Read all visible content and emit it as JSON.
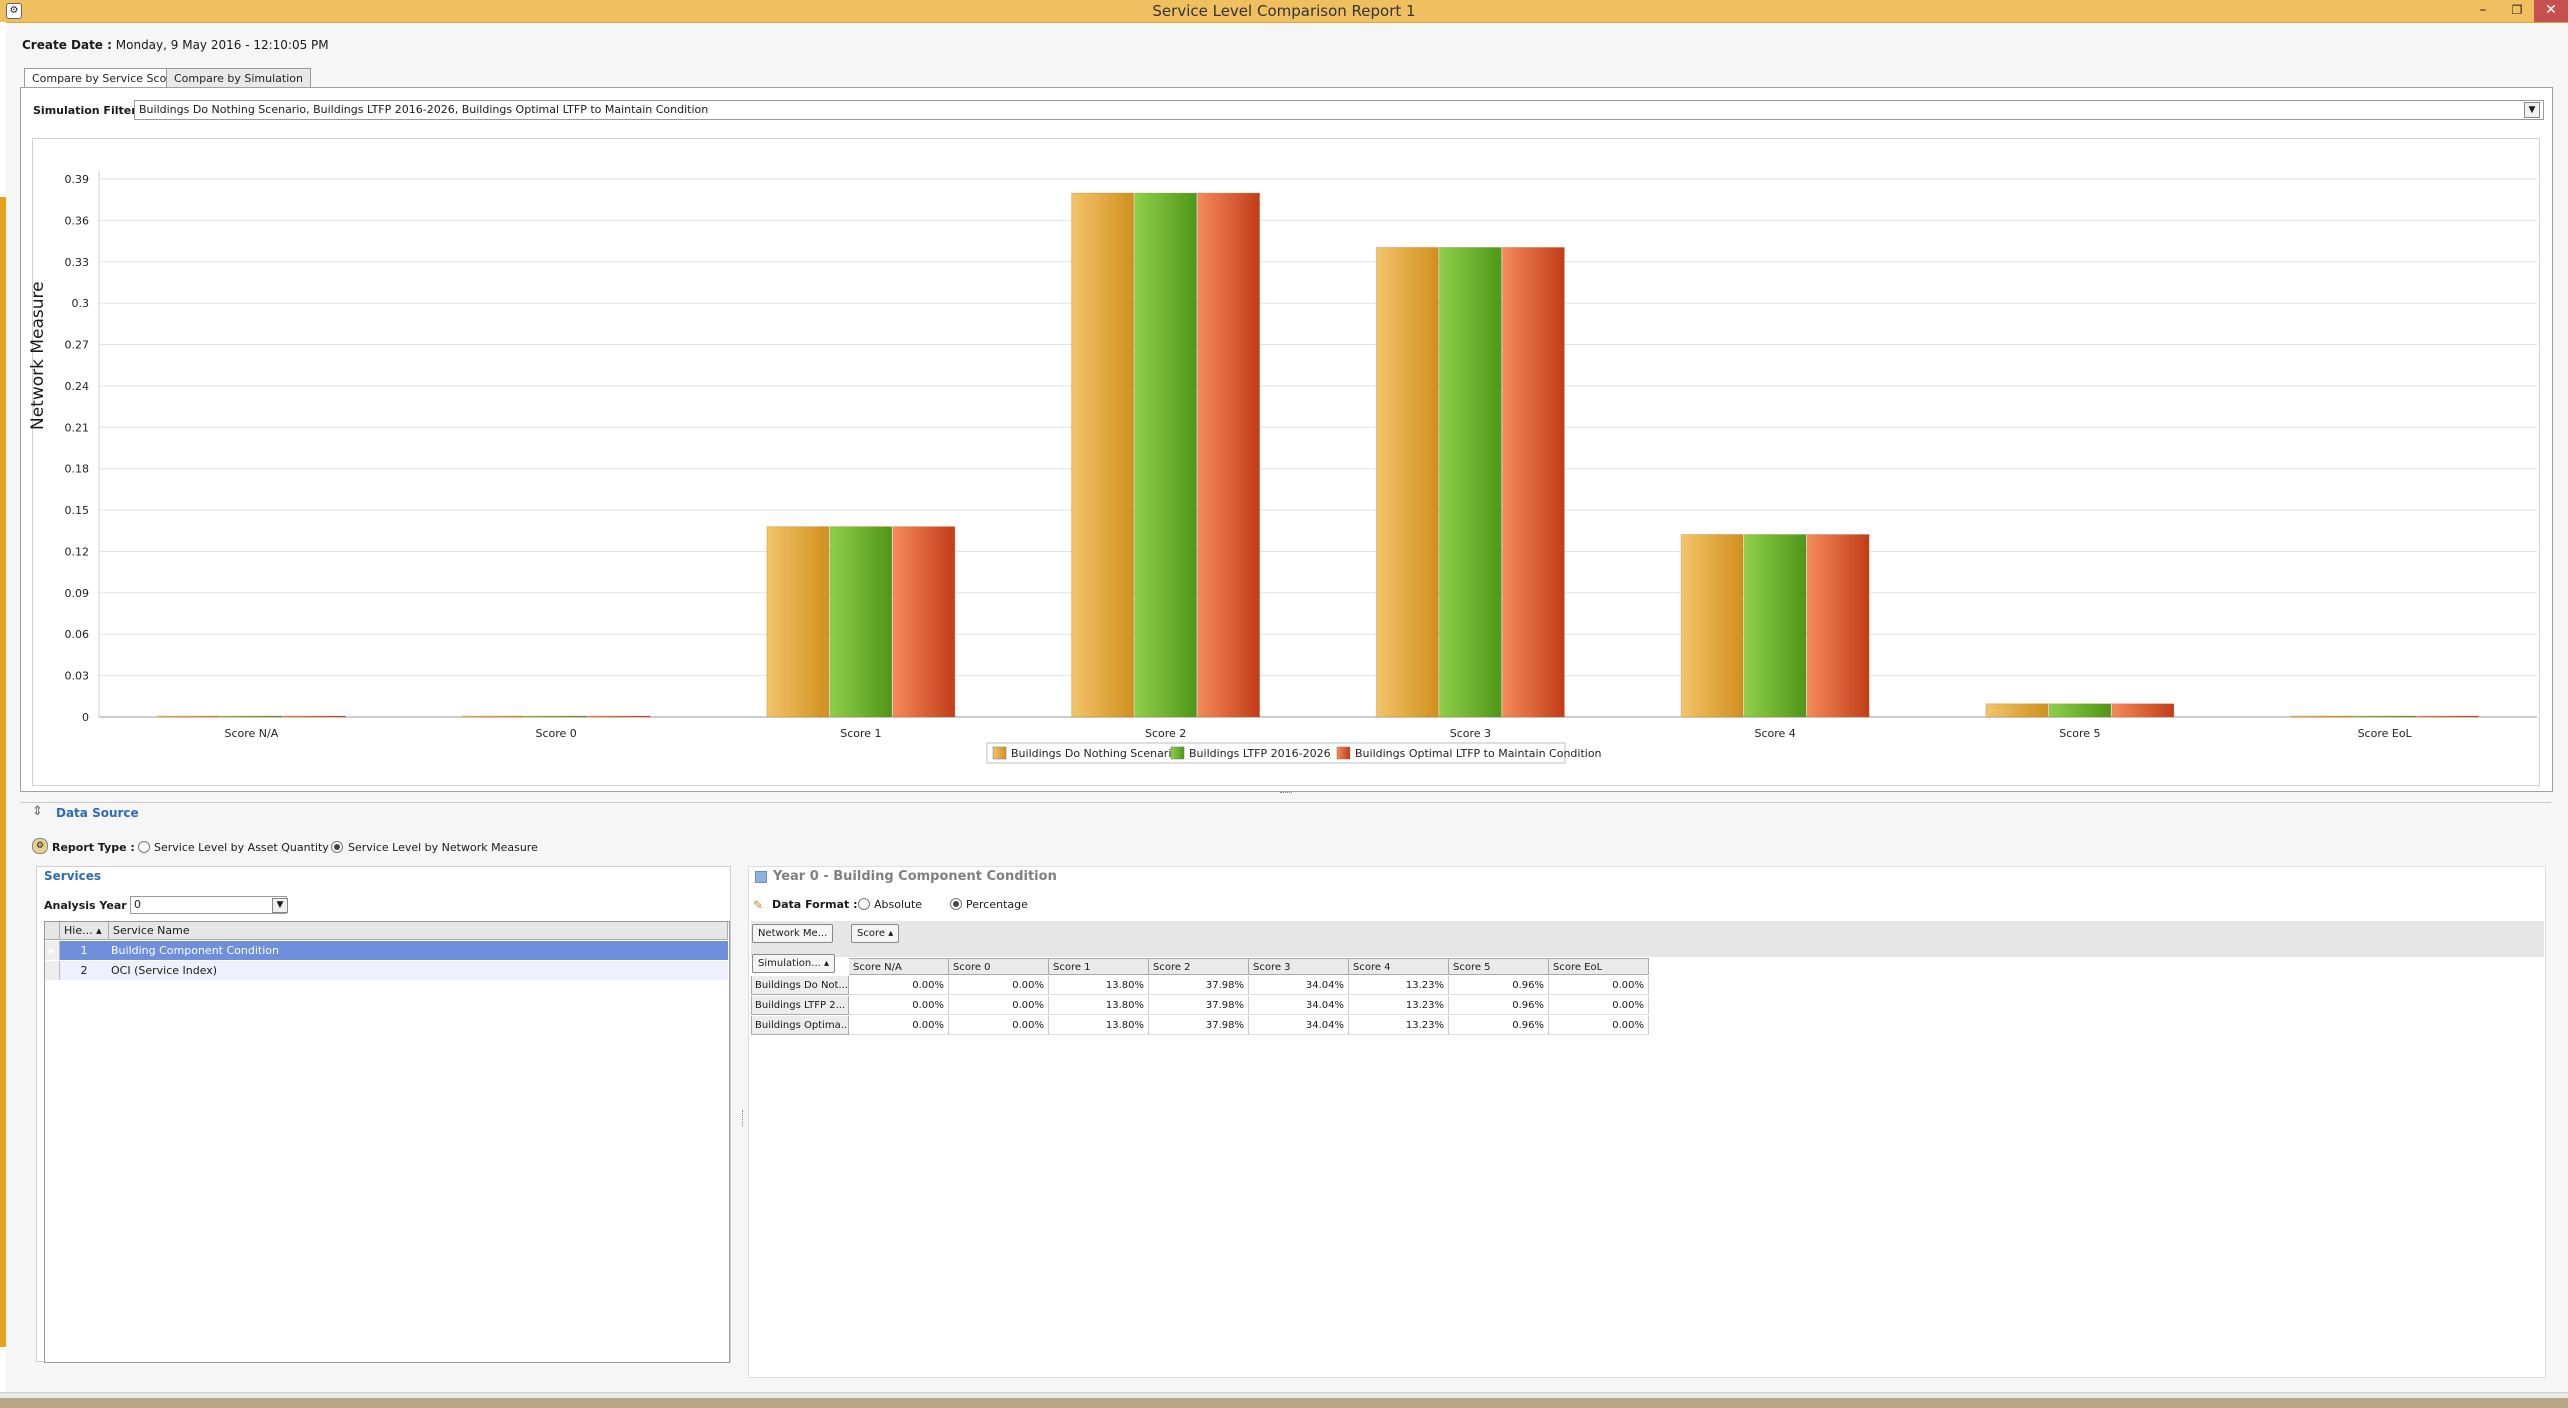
{
  "window": {
    "title": "Service Level Comparison Report 1",
    "min": "–",
    "max": "❐",
    "close": "✕"
  },
  "create_date": {
    "label": "Create Date :",
    "value": "Monday, 9 May 2016 - 12:10:05 PM"
  },
  "tabs": [
    {
      "label": "Compare by Service Score",
      "active": true
    },
    {
      "label": "Compare by Simulation",
      "active": false
    }
  ],
  "simulation_filter": {
    "label": "Simulation Filter :",
    "value": "Buildings Do Nothing Scenario, Buildings LTFP 2016-2026, Buildings Optimal LTFP to Maintain Condition"
  },
  "chart_data": {
    "type": "bar",
    "title": "",
    "xlabel": "",
    "ylabel": "Network Measure",
    "ylim": [
      0,
      0.39
    ],
    "yticks": [
      "0",
      "0.03",
      "0.06",
      "0.09",
      "0.12",
      "0.15",
      "0.18",
      "0.21",
      "0.24",
      "0.27",
      "0.3",
      "0.33",
      "0.36",
      "0.39"
    ],
    "categories": [
      "Score N/A",
      "Score 0",
      "Score 1",
      "Score 2",
      "Score 3",
      "Score 4",
      "Score 5",
      "Score EoL"
    ],
    "series": [
      {
        "name": "Buildings Do Nothing Scenario",
        "color": "#e8a83a",
        "values": [
          0,
          0,
          0.138,
          0.3798,
          0.3404,
          0.1323,
          0.0096,
          0
        ]
      },
      {
        "name": "Buildings LTFP 2016-2026",
        "color": "#6ab42a",
        "values": [
          0,
          0,
          0.138,
          0.3798,
          0.3404,
          0.1323,
          0.0096,
          0
        ]
      },
      {
        "name": "Buildings Optimal LTFP to Maintain Condition",
        "color": "#e0562a",
        "values": [
          0,
          0,
          0.138,
          0.3798,
          0.3404,
          0.1323,
          0.0096,
          0
        ]
      }
    ],
    "grid": true,
    "legend": "bottom-center"
  },
  "data_source": {
    "title": "Data Source"
  },
  "report_type": {
    "label": "Report Type :",
    "options": [
      {
        "label": "Service Level by Asset Quantity",
        "selected": false
      },
      {
        "label": "Service Level by Network Measure",
        "selected": true
      }
    ]
  },
  "services": {
    "title": "Services",
    "analysis_year_label": "Analysis Year :",
    "analysis_year": "0",
    "columns": [
      "Hie...",
      "Service Name"
    ],
    "rows": [
      {
        "hier": "1",
        "name": "Building Component Condition",
        "selected": true
      },
      {
        "hier": "2",
        "name": "OCI (Service Index)",
        "selected": false
      }
    ]
  },
  "results": {
    "title": "Year 0 - Building Component Condition",
    "data_format_label": "Data Format :",
    "formats": [
      {
        "label": "Absolute",
        "selected": false
      },
      {
        "label": "Percentage",
        "selected": true
      }
    ],
    "pivot_buttons": [
      "Network Me...",
      "Score"
    ],
    "row_field": "Simulation...",
    "columns": [
      "Score N/A",
      "Score 0",
      "Score 1",
      "Score 2",
      "Score 3",
      "Score 4",
      "Score 5",
      "Score EoL"
    ],
    "rows": [
      {
        "label": "Buildings Do Not...",
        "values": [
          "0.00%",
          "0.00%",
          "13.80%",
          "37.98%",
          "34.04%",
          "13.23%",
          "0.96%",
          "0.00%"
        ]
      },
      {
        "label": "Buildings LTFP 2...",
        "values": [
          "0.00%",
          "0.00%",
          "13.80%",
          "37.98%",
          "34.04%",
          "13.23%",
          "0.96%",
          "0.00%"
        ]
      },
      {
        "label": "Buildings Optima...",
        "values": [
          "0.00%",
          "0.00%",
          "13.80%",
          "37.98%",
          "34.04%",
          "13.23%",
          "0.96%",
          "0.00%"
        ]
      }
    ]
  }
}
